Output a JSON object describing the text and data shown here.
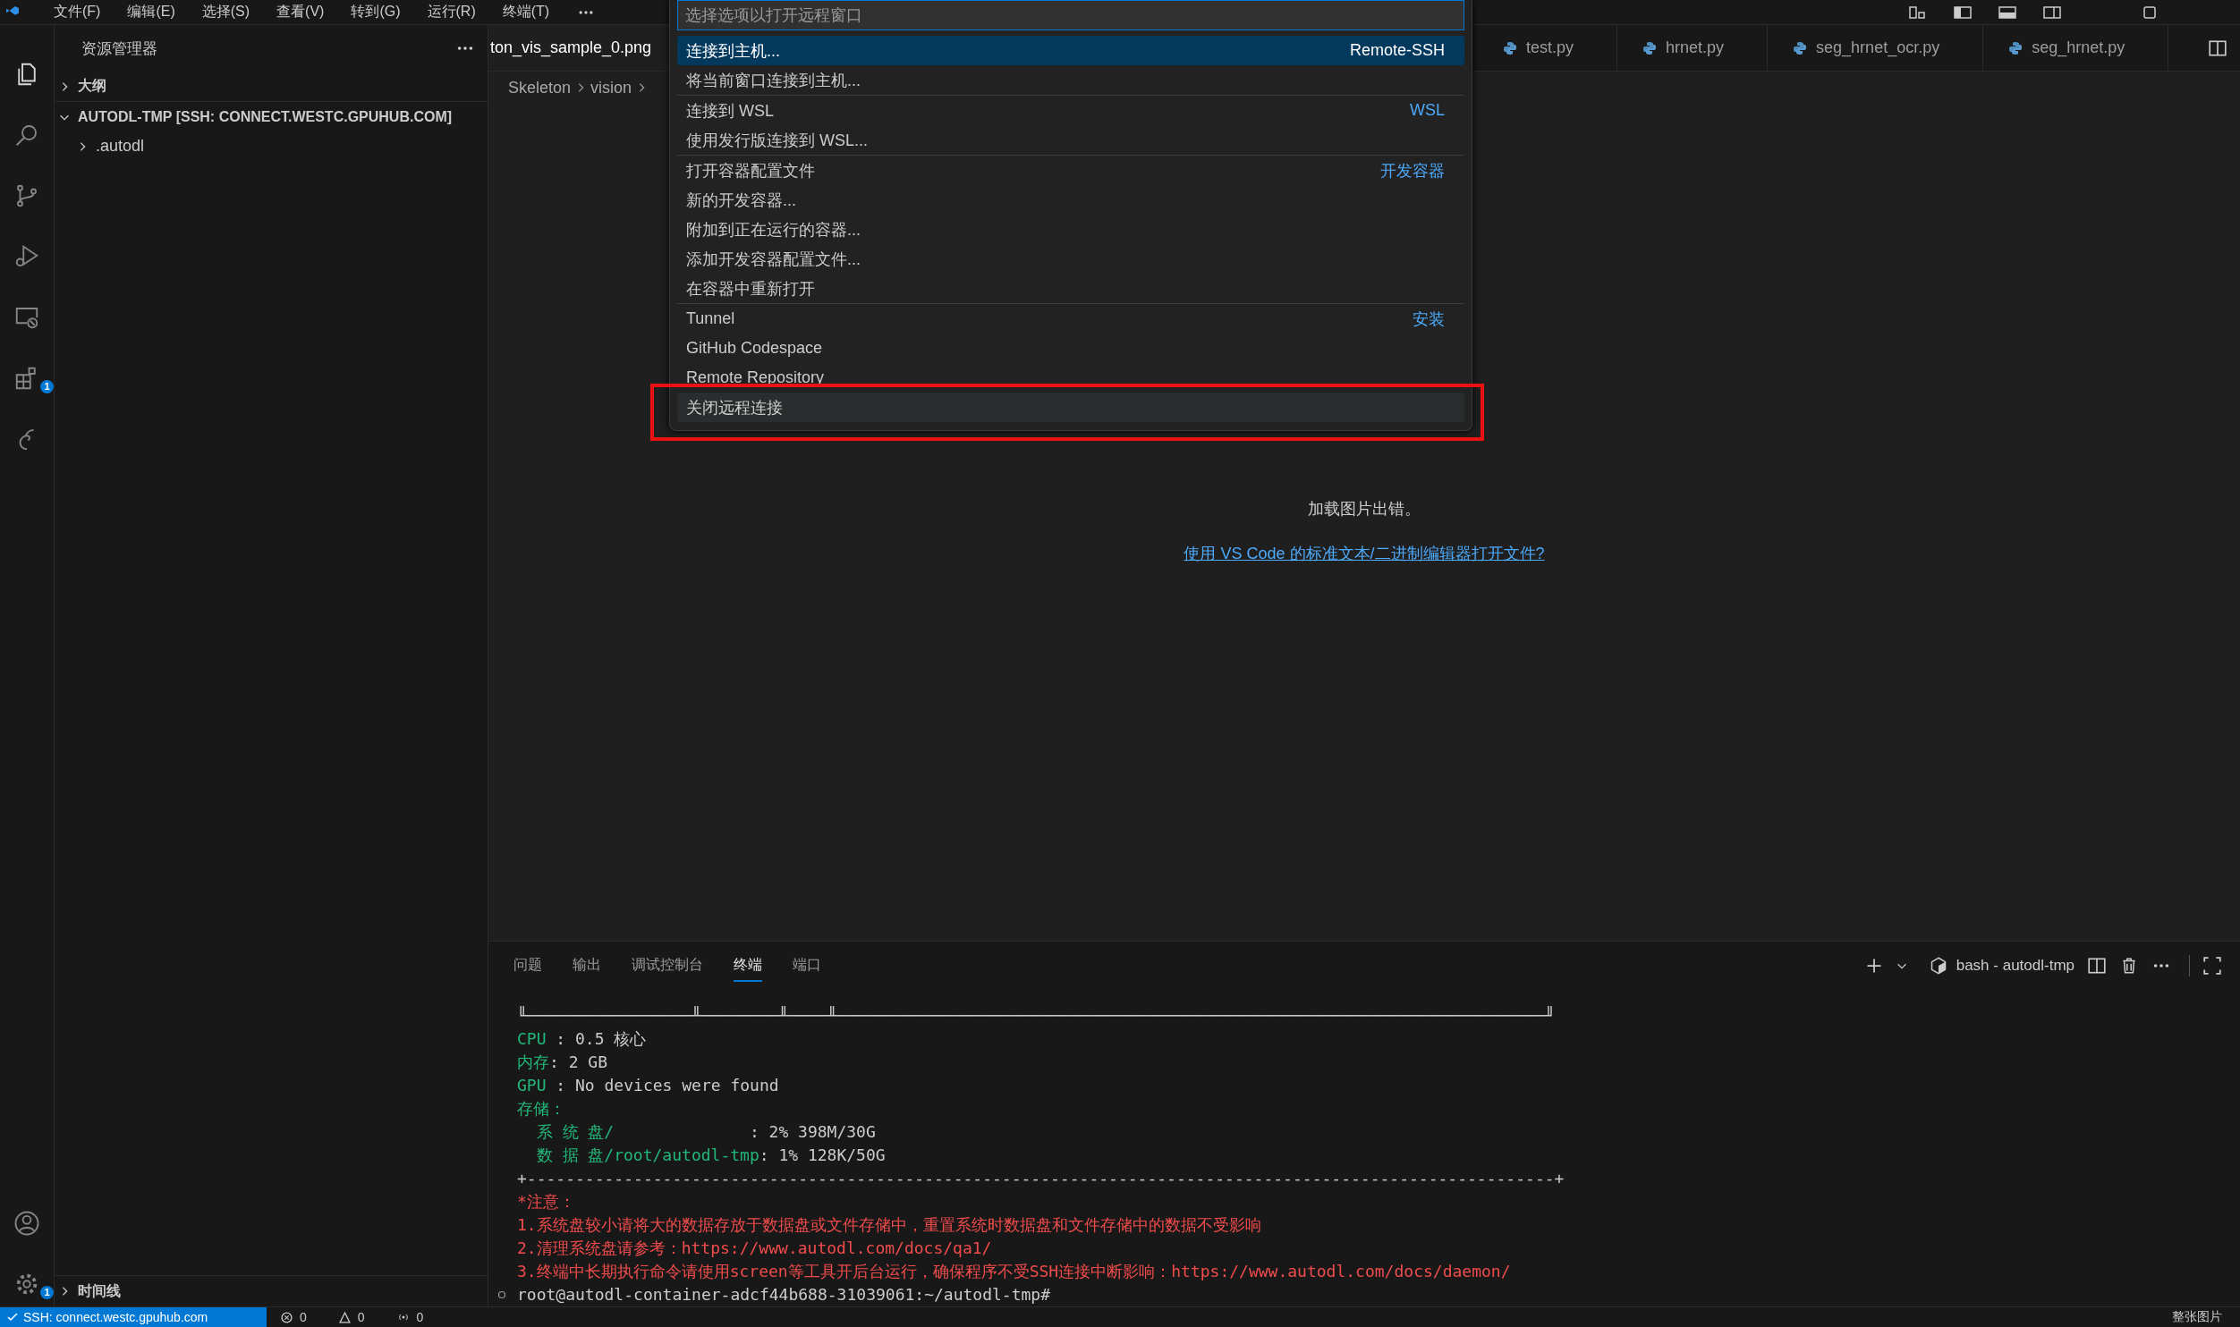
{
  "menu_bar": [
    "文件(F)",
    "编辑(E)",
    "选择(S)",
    "查看(V)",
    "转到(G)",
    "运行(R)",
    "终端(T)"
  ],
  "activity_bar": [
    {
      "kind": "explorer",
      "selected": true
    },
    {
      "kind": "search",
      "selected": false
    },
    {
      "kind": "source-control",
      "selected": false
    },
    {
      "kind": "run-debug",
      "selected": false
    },
    {
      "kind": "remote",
      "selected": false
    },
    {
      "kind": "extensions",
      "selected": false,
      "badge": "1"
    },
    {
      "kind": "spiral",
      "selected": false
    },
    {
      "kind": "account",
      "selected": false
    },
    {
      "kind": "settings",
      "selected": false,
      "badge": "1"
    }
  ],
  "sidebar": {
    "title": "资源管理器",
    "sections": [
      {
        "label": "大纲",
        "expanded": false
      },
      {
        "label": "AUTODL-TMP [SSH: CONNECT.WESTC.GPUHUB.COM]",
        "expanded": true,
        "children": [
          {
            "label": ".autodl",
            "expanded": false
          }
        ]
      }
    ],
    "timeline": {
      "label": "时间线",
      "expanded": false
    }
  },
  "tabs": [
    {
      "label": "ton_vis_sample_0.png",
      "kind": "image",
      "selected": true
    },
    {
      "label": "test.py",
      "kind": "python",
      "selected": false
    },
    {
      "label": "hrnet.py",
      "kind": "python",
      "selected": false
    },
    {
      "label": "seg_hrnet_ocr.py",
      "kind": "python",
      "selected": false
    },
    {
      "label": "seg_hrnet.py",
      "kind": "python",
      "selected": false
    }
  ],
  "breadcrumb": [
    "Skeleton",
    "vision"
  ],
  "editor": {
    "message": "加载图片出错。",
    "link": "使用 VS Code 的标准文本/二进制编辑器打开文件?"
  },
  "quick_pick": {
    "placeholder": "选择选项以打开远程窗口",
    "groups": [
      {
        "items": [
          {
            "label": "连接到主机...",
            "detail": "Remote-SSH",
            "selected": true
          },
          {
            "label": "将当前窗口连接到主机...",
            "selected": false
          }
        ]
      },
      {
        "items": [
          {
            "label": "连接到 WSL",
            "detail": "WSL",
            "selected": false
          },
          {
            "label": "使用发行版连接到 WSL...",
            "selected": false
          }
        ]
      },
      {
        "items": [
          {
            "label": "打开容器配置文件",
            "detail": "开发容器",
            "selected": false
          },
          {
            "label": "新的开发容器...",
            "selected": false
          },
          {
            "label": "附加到正在运行的容器...",
            "selected": false
          },
          {
            "label": "添加开发容器配置文件...",
            "selected": false
          },
          {
            "label": "在容器中重新打开",
            "selected": false
          }
        ]
      },
      {
        "items": [
          {
            "label": "Tunnel",
            "detail": "安装",
            "selected": false
          },
          {
            "label": "GitHub Codespace",
            "selected": false
          },
          {
            "label": "Remote Repository",
            "selected": false
          }
        ]
      }
    ],
    "footer": {
      "label": "关闭远程连接",
      "hovered": true
    }
  },
  "panel": {
    "tabs": [
      {
        "label": "问题",
        "selected": false
      },
      {
        "label": "输出",
        "selected": false
      },
      {
        "label": "调试控制台",
        "selected": false
      },
      {
        "label": "终端",
        "selected": true
      },
      {
        "label": "端口",
        "selected": false
      }
    ],
    "terminal_name": "bash - autodl-tmp",
    "lines": [
      [
        {
          "text": "╙─────────────────╨────────╨────╨─────────────────────────────────────────────────────────────────────────╜",
          "kind": "plain"
        }
      ],
      [
        {
          "text": "CPU",
          "kind": "label"
        },
        {
          "text": " : 0.5 核心",
          "kind": "plain"
        }
      ],
      [
        {
          "text": "内存",
          "kind": "label"
        },
        {
          "text": ": 2 GB",
          "kind": "plain"
        }
      ],
      [
        {
          "text": "GPU",
          "kind": "label"
        },
        {
          "text": " : No devices were found",
          "kind": "plain"
        }
      ],
      [
        {
          "text": "存储：",
          "kind": "label"
        }
      ],
      [
        {
          "text": "  系 统 盘/",
          "kind": "label"
        },
        {
          "text": "              : 2% 398M/30G",
          "kind": "plain"
        }
      ],
      [
        {
          "text": "  数 据 盘/root/autodl-tmp",
          "kind": "label"
        },
        {
          "text": ": 1% 128K/50G",
          "kind": "plain"
        }
      ],
      [
        {
          "text": "+----------------------------------------------------------------------------------------------------------+",
          "kind": "plain"
        }
      ],
      [
        {
          "text": "*注意：",
          "kind": "warning"
        }
      ],
      [
        {
          "text": "1.系统盘较小请将大的数据存放于数据盘或文件存储中，重置系统时数据盘和文件存储中的数据不受影响",
          "kind": "warning"
        }
      ],
      [
        {
          "text": "2.清理系统盘请参考：https://www.autodl.com/docs/qa1/",
          "kind": "warning"
        }
      ],
      [
        {
          "text": "3.终端中长期执行命令请使用screen等工具开后台运行，确保程序不受SSH连接中断影响：https://www.autodl.com/docs/daemon/",
          "kind": "warning"
        }
      ]
    ],
    "prompt": "root@autodl-container-adcf44b688-31039061:~/autodl-tmp#"
  },
  "status_bar": {
    "remote": "SSH: connect.westc.gpuhub.com",
    "errors": "0",
    "warnings": "0",
    "ports": "0",
    "right": "整张图片"
  }
}
